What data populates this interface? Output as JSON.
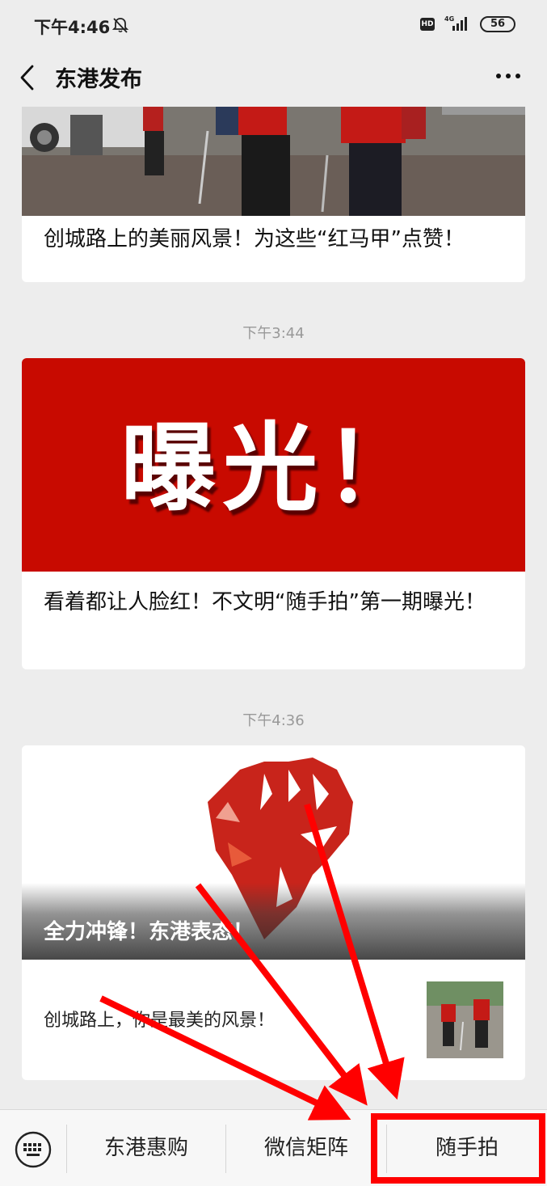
{
  "status_bar": {
    "time": "下午4:46",
    "hd_label": "HD",
    "network_label": "4G",
    "battery": "56"
  },
  "nav": {
    "title": "东港发布"
  },
  "feed": {
    "article1": {
      "title": "创城路上的美丽风景！为这些“红马甲”点赞！"
    },
    "time1": "下午3:44",
    "article2": {
      "banner_text": "曝光！",
      "title": "看着都让人脸红！不文明“随手拍”第一期曝光！"
    },
    "time2": "下午4:36",
    "article3": {
      "cover_title": "全力冲锋！东港表态！",
      "sub_title": "创城路上，你是最美的风景！"
    }
  },
  "menu": {
    "items": [
      {
        "label": "东港惠购"
      },
      {
        "label": "微信矩阵"
      },
      {
        "label": "随手拍"
      }
    ]
  },
  "colors": {
    "banner_red": "#c80a00",
    "annotation_red": "#ff0000",
    "background": "#ededed"
  }
}
